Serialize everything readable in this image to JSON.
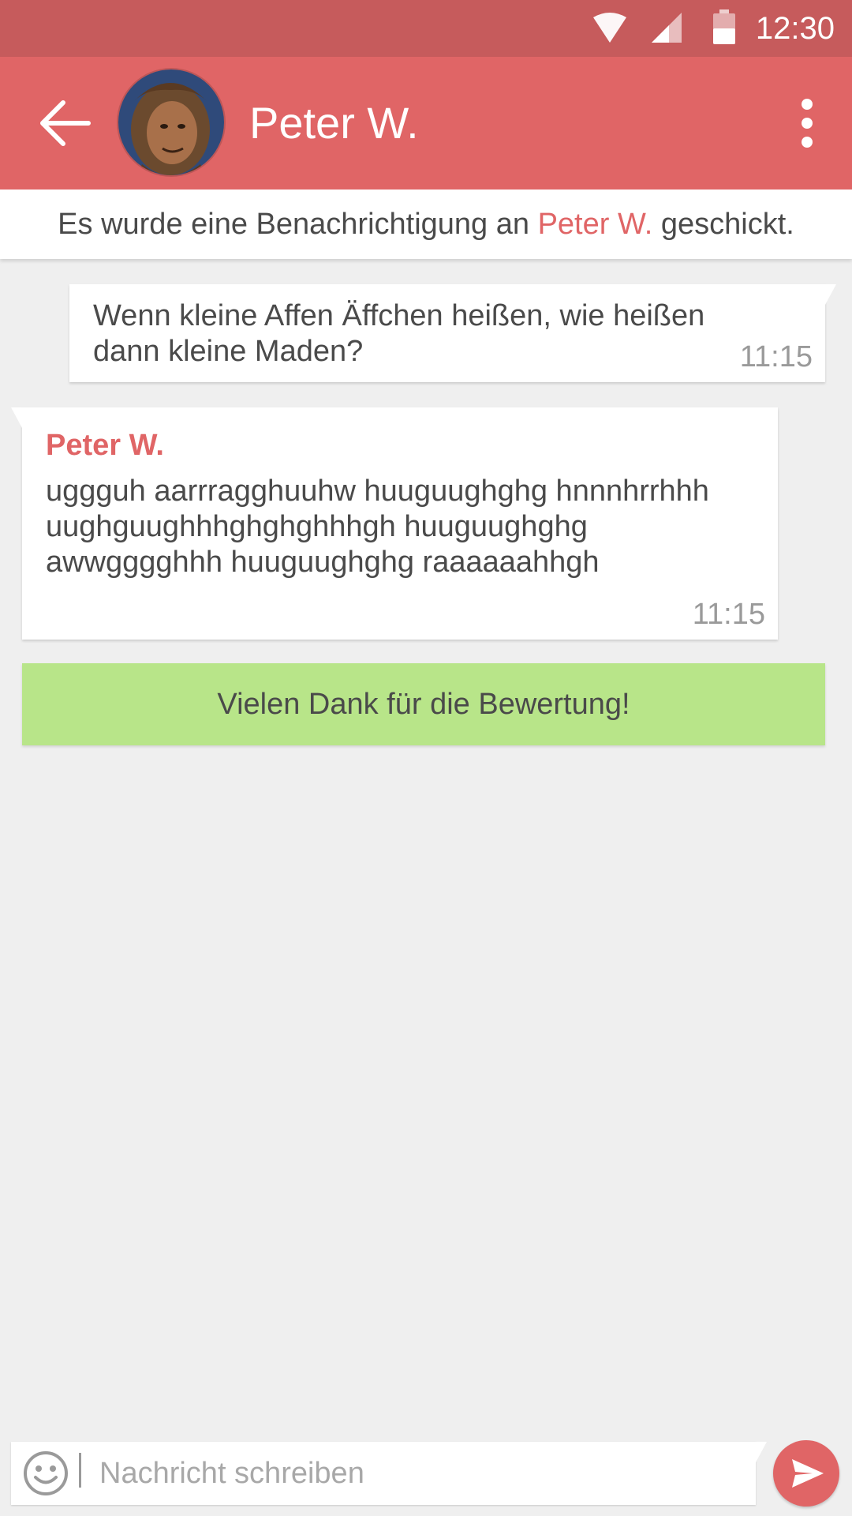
{
  "status_bar": {
    "time": "12:30",
    "icons": [
      "wifi-icon",
      "cellular-signal-icon",
      "battery-icon"
    ]
  },
  "app_bar": {
    "contact_name": "Peter W.",
    "back_icon": "arrow-left-icon",
    "menu_icon": "more-vertical-icon",
    "colors": {
      "primary": "#e06566",
      "status_bar": "#c65b5c"
    }
  },
  "notice": {
    "prefix": "Es wurde eine Benachrichtigung an",
    "name": "Peter W.",
    "suffix": "geschickt."
  },
  "messages": [
    {
      "direction": "sent",
      "text": "Wenn kleine Affen Äffchen heißen, wie heißen dann kleine Maden?",
      "time": "11:15"
    },
    {
      "direction": "received",
      "sender": "Peter W.",
      "text": "uggguh aarrragghuuhw huuguughghg hnnnhrrhhh uughguughhhghghghhhgh huuguughghg awwgggghhh huuguughghg raaaaaahhgh",
      "time": "11:15"
    }
  ],
  "rating_banner": {
    "text": "Vielen Dank für die Bewertung!",
    "color": "#b8e589"
  },
  "composer": {
    "placeholder": "Nachricht schreiben",
    "value": "",
    "emoji_icon": "smiley-icon",
    "send_icon": "send-icon"
  }
}
